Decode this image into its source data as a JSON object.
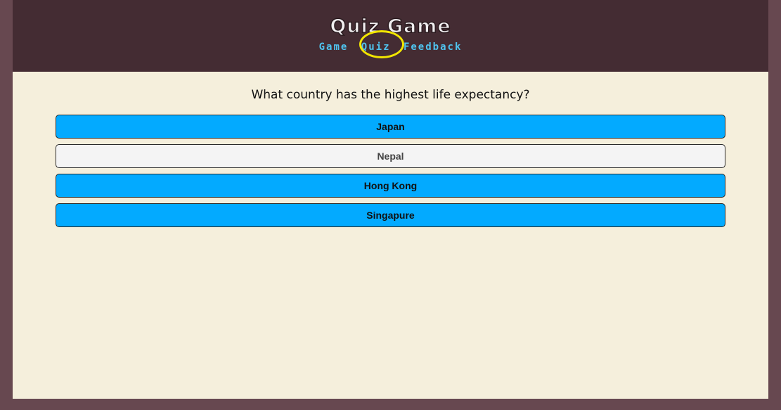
{
  "header": {
    "title": "Quiz Game",
    "nav": [
      {
        "label": "Game"
      },
      {
        "label": "Quiz"
      },
      {
        "label": "Feedback"
      }
    ]
  },
  "quiz": {
    "question": "What country has the highest life expectancy?",
    "answers": [
      {
        "label": "Japan"
      },
      {
        "label": "Nepal"
      },
      {
        "label": "Hong Kong"
      },
      {
        "label": "Singapure"
      }
    ]
  },
  "colors": {
    "page_bg": "#674850",
    "header_bg": "#442c33",
    "content_bg": "#f5efdc",
    "answer_primary": "#03aaff",
    "answer_alt": "#f4f4f4",
    "nav_link": "#4fc3ee",
    "highlight": "#f2e600"
  }
}
